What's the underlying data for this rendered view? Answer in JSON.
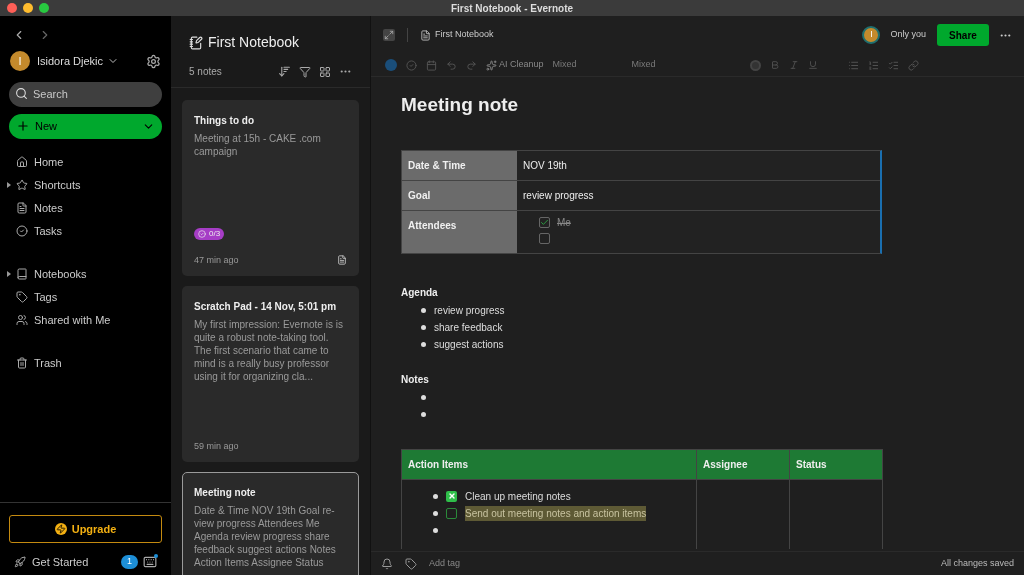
{
  "window": {
    "title": "First Notebook - Evernote"
  },
  "sidebar": {
    "user": "Isidora Djekic",
    "avatar": "I",
    "search": {
      "placeholder": "Search"
    },
    "new_button": "New",
    "groups": [
      [
        {
          "label": "Home",
          "kind": "link"
        },
        {
          "label": "Shortcuts",
          "kind": "group"
        },
        {
          "label": "Notes",
          "kind": "link"
        },
        {
          "label": "Tasks",
          "kind": "link"
        }
      ],
      [
        {
          "label": "Notebooks",
          "kind": "group"
        },
        {
          "label": "Tags",
          "kind": "link"
        },
        {
          "label": "Shared with Me",
          "kind": "link"
        }
      ],
      [
        {
          "label": "Trash",
          "kind": "link"
        }
      ]
    ],
    "upgrade": "Upgrade",
    "get_started": "Get Started",
    "badge": "1"
  },
  "note_list": {
    "title": "First Notebook",
    "count": "5 notes",
    "notes": [
      {
        "title": "Things to do",
        "snippet": "Meeting at 15h - CAKE .com campaign",
        "tasks": "0/3",
        "time": "47 min ago",
        "selected": false
      },
      {
        "title": "Scratch Pad - 14 Nov, 5:01 pm",
        "snippet": "My first impression: Evernote is is quite a robust note-taking tool. The first scenario that came to mind is a really busy professor using it for organizing cla...",
        "time": "59 min ago",
        "selected": false
      },
      {
        "title": "Meeting note",
        "snippet": "Date & Time NOV 19th Goal re-view progress Attendees Me Agenda review progress share feedback suggest actions Notes Action Items Assignee Status",
        "selected": true
      }
    ]
  },
  "editor": {
    "breadcrumb": "First Notebook",
    "avatar": "I",
    "sharing": "Only you",
    "share": "Share",
    "toolbar": {
      "ai_cleanup": "AI Cleanup",
      "font": "Mixed",
      "size": "Mixed"
    },
    "title": "Meeting note",
    "info_table": [
      {
        "label": "Date & Time",
        "kind": "text",
        "value": "NOV 19th"
      },
      {
        "label": "Goal",
        "kind": "text",
        "value": "review progress"
      },
      {
        "label": "Attendees",
        "kind": "checklist",
        "items": [
          {
            "text": "Me",
            "checked": true
          },
          {
            "checked": false
          }
        ]
      }
    ],
    "sections": [
      {
        "heading": "Agenda",
        "items": [
          {
            "kind": "text",
            "text": "review progress"
          },
          {
            "kind": "text",
            "text": "share feedback"
          },
          {
            "kind": "text",
            "text": "suggest actions"
          }
        ]
      },
      {
        "heading": "Notes",
        "items": [
          {
            "kind": "empty"
          },
          {
            "kind": "empty"
          }
        ]
      }
    ],
    "action_table": {
      "columns": [
        "Action Items",
        "Assignee",
        "Status"
      ],
      "items": [
        {
          "kind": "task",
          "text": "Clean up meeting notes",
          "checked": true,
          "highlighted": false
        },
        {
          "kind": "task",
          "text": "Send out meeting notes and action items",
          "checked": false,
          "highlighted": true
        },
        {
          "kind": "empty"
        }
      ]
    },
    "add_tag": "Add tag",
    "status": "All changes saved"
  }
}
